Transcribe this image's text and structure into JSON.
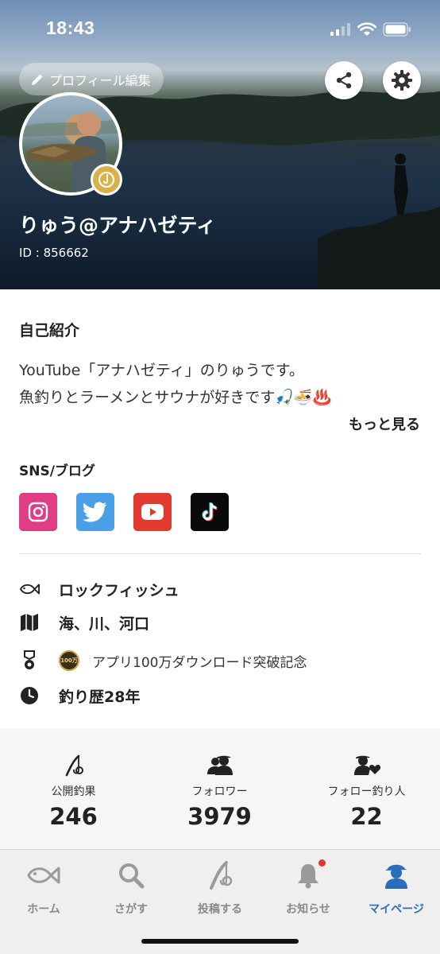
{
  "status_bar": {
    "time": "18:43"
  },
  "header": {
    "edit_profile_label": "プロフィール編集",
    "username": "りゅう@アナハゼティ",
    "user_id": "ID : 856662"
  },
  "bio": {
    "title": "自己紹介",
    "line1": "YouTube「アナハゼティ」のりゅうです。",
    "line2": "魚釣りとラーメンとサウナが好きです🎣🍜♨️",
    "more_label": "もっと見る"
  },
  "sns": {
    "title": "SNS/ブログ",
    "items": [
      "instagram-icon",
      "twitter-icon",
      "youtube-icon",
      "tiktok-icon"
    ]
  },
  "details": {
    "target_fish": "ロックフィッシュ",
    "fishing_places": "海、川、河口",
    "medal_text": "100万",
    "award": "アプリ100万ダウンロード突破記念",
    "experience": "釣り歴28年"
  },
  "stats": [
    {
      "label": "公開釣果",
      "value": "246"
    },
    {
      "label": "フォロワー",
      "value": "3979"
    },
    {
      "label": "フォロー釣り人",
      "value": "22"
    }
  ],
  "tabs": [
    {
      "label": "ホーム"
    },
    {
      "label": "さがす"
    },
    {
      "label": "投稿する"
    },
    {
      "label": "お知らせ"
    },
    {
      "label": "マイページ"
    }
  ],
  "colors": {
    "accent": "#2a6fba",
    "notification_dot": "#d93a2e",
    "instagram": "#e03d86",
    "twitter": "#4a9fe6",
    "youtube": "#e03a2e",
    "tiktok": "#0a0a0a"
  }
}
